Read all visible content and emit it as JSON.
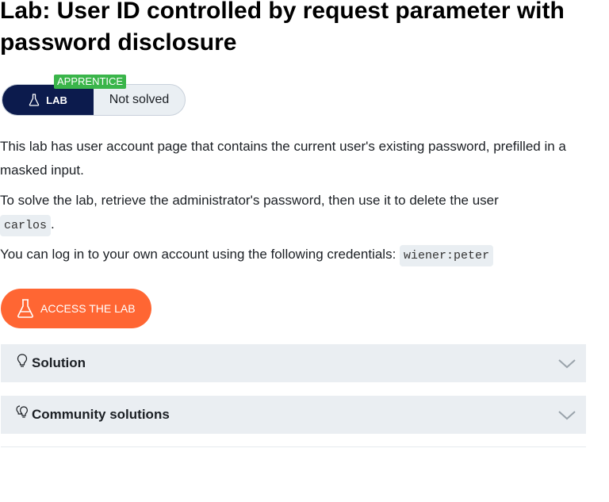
{
  "lab": {
    "title": "Lab: User ID controlled by request parameter with password disclosure",
    "level_badge": "APPRENTICE",
    "lab_label": "LAB",
    "status": "Not solved"
  },
  "description": {
    "p1": "This lab has user account page that contains the current user's existing password, prefilled in a masked input.",
    "p2_before": "To solve the lab, retrieve the administrator's password, then use it to delete the user",
    "p2_code": "carlos",
    "p2_after": ".",
    "p3_before": "You can log in to your own account using the following credentials:",
    "p3_code": "wiener:peter"
  },
  "actions": {
    "access_lab": "ACCESS THE LAB"
  },
  "accordions": {
    "solution": "Solution",
    "community": "Community solutions"
  },
  "colors": {
    "lab_navy": "#0c1b4d",
    "level_green": "#3ab54a",
    "access_orange": "#ff6633",
    "accordion_bg": "#eaeef2"
  },
  "icons": {
    "lab": "flask-icon",
    "access": "flask-icon",
    "solution": "lightbulb-icon",
    "community": "lightbulbs-icon",
    "expand": "chevron-down-icon"
  }
}
